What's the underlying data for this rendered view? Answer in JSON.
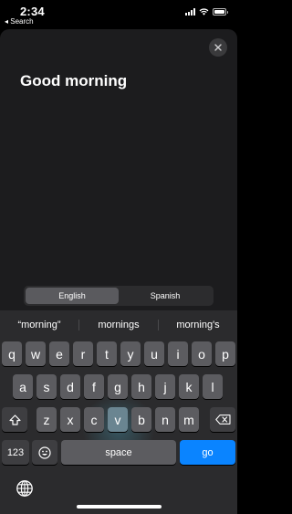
{
  "status_bar": {
    "time": "2:34",
    "back_label": "◂ Search",
    "battery_level": 1.0
  },
  "card": {
    "phrase": "Good morning",
    "close_icon": "xmark-icon"
  },
  "language_toggle": {
    "options": [
      "English",
      "Spanish"
    ],
    "selected": "English"
  },
  "keyboard": {
    "suggestions": [
      "“morning”",
      "mornings",
      "morning's"
    ],
    "row1": [
      "q",
      "w",
      "e",
      "r",
      "t",
      "y",
      "u",
      "i",
      "o",
      "p"
    ],
    "row2": [
      "a",
      "s",
      "d",
      "f",
      "g",
      "h",
      "j",
      "k",
      "l"
    ],
    "row3": [
      "z",
      "x",
      "c",
      "v",
      "b",
      "n",
      "m"
    ],
    "numbers_label": "123",
    "space_label": "space",
    "go_label": "go",
    "pressed_key": "v",
    "icons": [
      "shift-icon",
      "delete-icon",
      "emoji-icon",
      "globe-icon"
    ],
    "accent_color": "#0a84ff"
  }
}
